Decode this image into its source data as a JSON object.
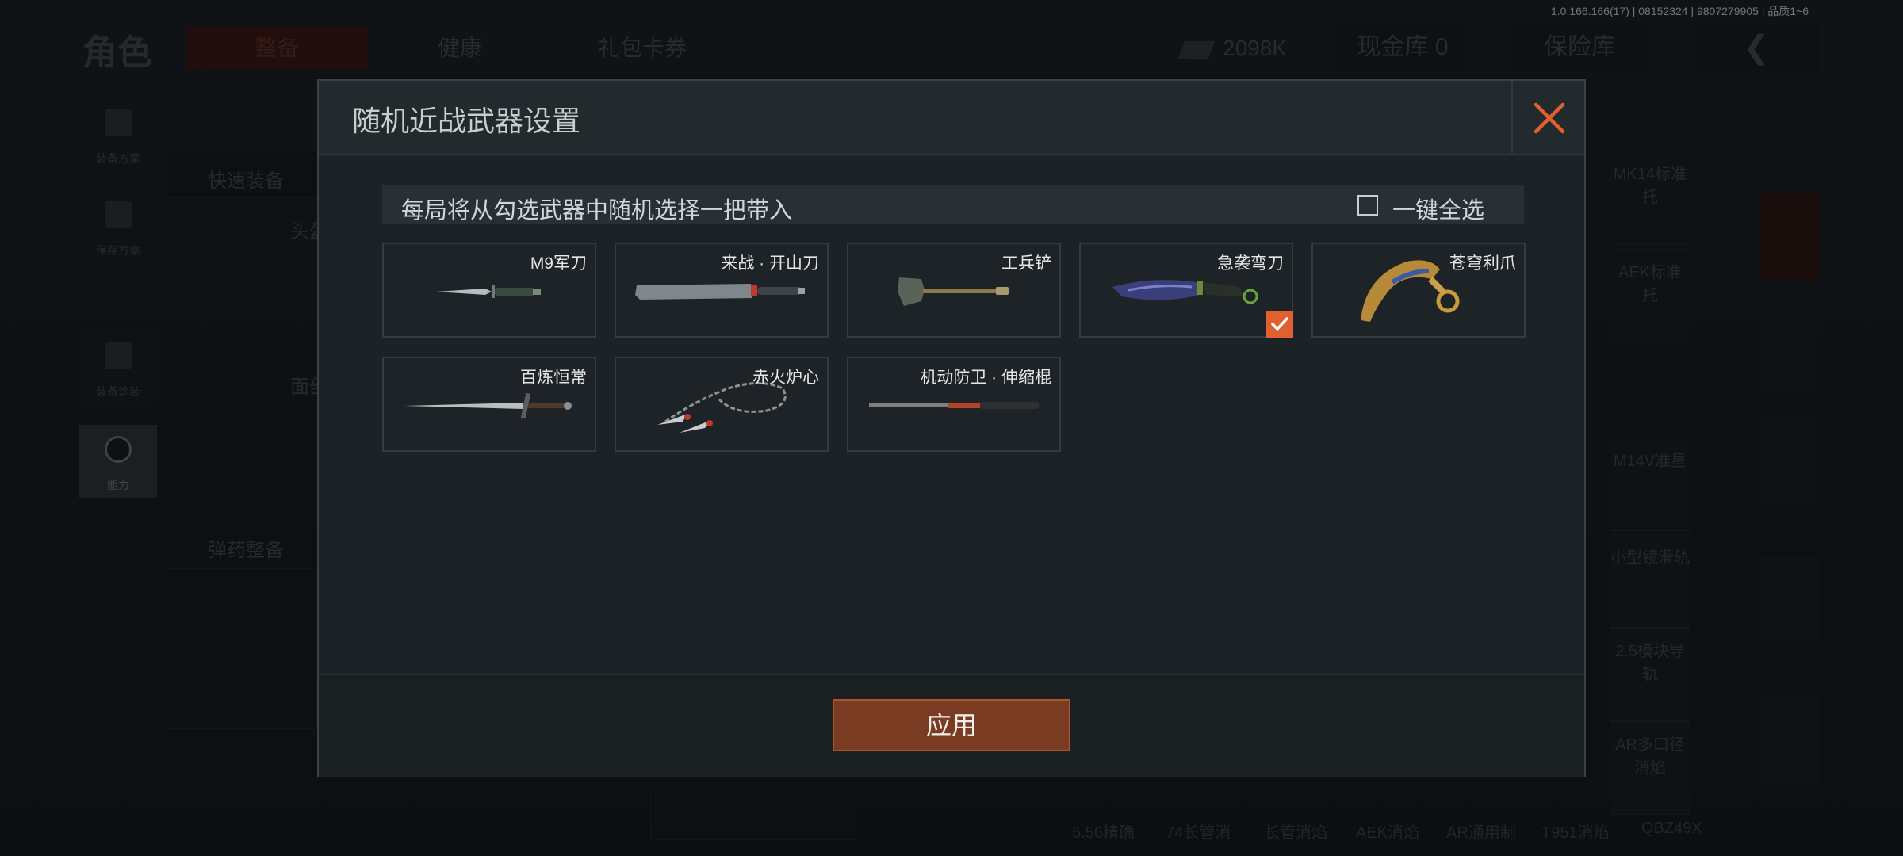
{
  "background": {
    "title": "角色",
    "tabs": [
      "整备",
      "健康",
      "礼包卡券"
    ],
    "money": "2098K",
    "cash_vault": "现金库 0",
    "insurance": "保险库",
    "build_info": "1.0.166.166(17) | 08152324 | 9807279905 | 品质1~6",
    "side_items": [
      "装备方案",
      "保存方案",
      "装备涂装",
      "能力"
    ],
    "quick_equip": "快速装备",
    "ammo_equip": "弹药整备",
    "head_label": "头盔",
    "face_label": "面部",
    "right_items": [
      "MK14标准托",
      "AEK标准托",
      "M14V准星",
      "小型镜滑轨",
      "2.5模块导轨",
      "AR多口径消焰"
    ],
    "bottom_items": [
      "5.56精确",
      "74长管消",
      "长管消焰",
      "AEK消焰",
      "AR通用制",
      "T951消焰",
      "QBZ49X"
    ]
  },
  "modal": {
    "title": "随机近战武器设置",
    "close_icon": "close-icon",
    "info_text": "每局将从勾选武器中随机选择一把带入",
    "select_all_label": "一键全选",
    "select_all_checked": false,
    "accent_color": "#e0612f",
    "weapons": [
      {
        "name": "M9军刀",
        "checked": false
      },
      {
        "name": "来战 · 开山刀",
        "checked": false
      },
      {
        "name": "工兵铲",
        "checked": false
      },
      {
        "name": "急袭弯刀",
        "checked": true
      },
      {
        "name": "苍穹利爪",
        "checked": false
      },
      {
        "name": "百炼恒常",
        "checked": false
      },
      {
        "name": "赤火炉心",
        "checked": false
      },
      {
        "name": "机动防卫 · 伸缩棍",
        "checked": false
      }
    ],
    "apply_label": "应用"
  }
}
